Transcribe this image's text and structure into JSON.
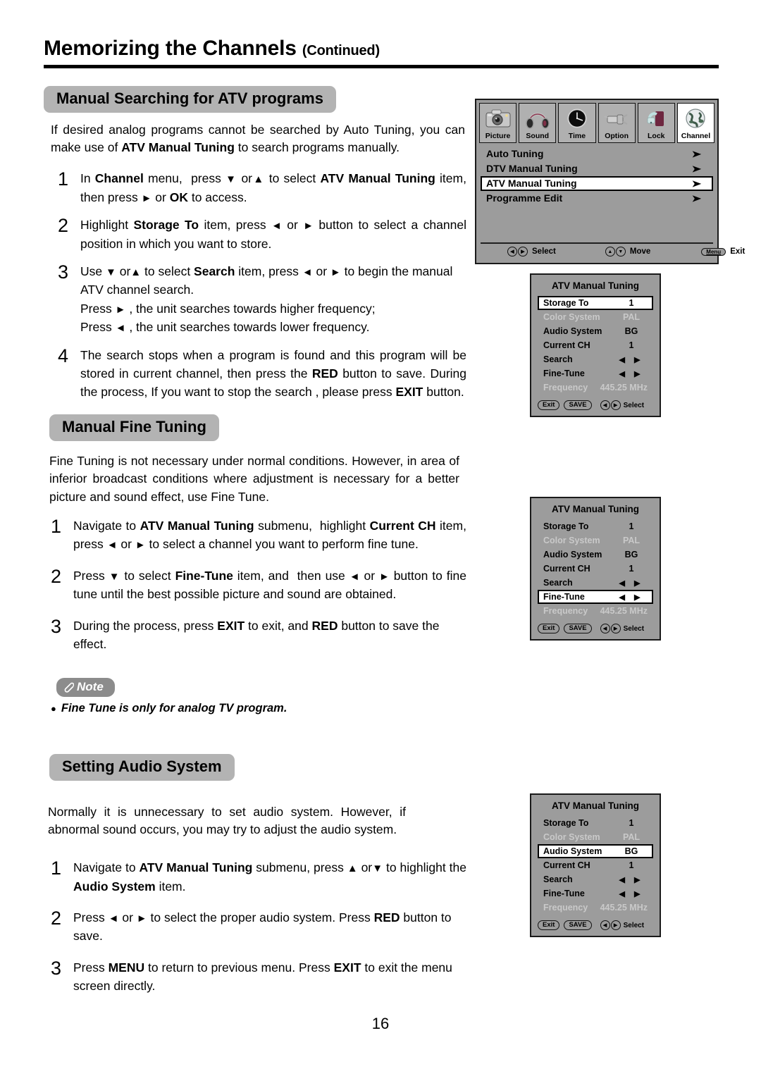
{
  "page": {
    "title": "Memorizing the Channels",
    "title_suffix": "(Continued)",
    "number": "16"
  },
  "sections": {
    "manual_search": {
      "heading": "Manual Searching for ATV programs",
      "intro_html": "If desired analog programs cannot be searched by Auto Tuning, you can make use of <b>ATV Manual Tuning</b> to search programs manually.",
      "steps": [
        {
          "num": "1",
          "html": "In <b>Channel</b> menu,&nbsp; press <span class=\"ar\">&#9660;</span> or<span class=\"ar\">&#9650;</span> to select <b>ATV Manual Tuning</b> item, then press <span class=\"ar\">&#9658;</span> or <b>OK</b> to access."
        },
        {
          "num": "2",
          "html": "Highlight <b>Storage To</b> item, press <span class=\"ar\">&#9668;</span> or <span class=\"ar\">&#9658;</span> button to select a channel position in which you want to store."
        },
        {
          "num": "3",
          "html": "Use <span class=\"ar\">&#9660;</span> or<span class=\"ar\">&#9650;</span> to select <b>Search</b> item, press <span class=\"ar\">&#9668;</span> or <span class=\"ar\">&#9658;</span> to begin the manual ATV channel search.<br>Press <span class=\"ar\">&#9658;</span> , the unit searches towards higher frequency;<br>Press <span class=\"ar\">&#9668;</span> , the unit searches towards lower frequency."
        },
        {
          "num": "4",
          "html": "The search stops when a program is found and this program will be stored in current channel, then press the <b>RED</b> button to save. During the process, If you want to stop the search , please press <b>EXIT</b> button."
        }
      ]
    },
    "fine_tuning": {
      "heading": "Manual Fine Tuning",
      "intro_html": "Fine Tuning is not necessary under normal conditions. However, in area of inferior broadcast conditions where adjustment is necessary for a better picture and sound effect, use Fine Tune.",
      "steps": [
        {
          "num": "1",
          "html": "Navigate to <b>ATV Manual Tuning</b> submenu,&nbsp; highlight <b>Current CH</b> item, press <span class=\"ar\">&#9668;</span> or <span class=\"ar\">&#9658;</span> to select a channel you want to perform fine tune."
        },
        {
          "num": "2",
          "html": "Press <span class=\"ar\">&#9660;</span> to select <b>Fine-Tune</b> item, and&nbsp; then use <span class=\"ar\">&#9668;</span> or <span class=\"ar\">&#9658;</span> button to fine tune until the best possible picture and sound are obtained."
        },
        {
          "num": "3",
          "html": "During the process, press <b>EXIT</b> to exit, and <b>RED</b> button to save the effect."
        }
      ],
      "note_label": "Note",
      "note_items": [
        "Fine Tune is only for analog TV program."
      ]
    },
    "audio_system": {
      "heading": "Setting Audio System",
      "intro_html": "Normally it is unnecessary to set audio system. However, if abnormal sound occurs, you may try to adjust the audio system.",
      "steps": [
        {
          "num": "1",
          "html": "Navigate to <b>ATV Manual Tuning</b> submenu, press <span class=\"ar\">&#9650;</span> or<span class=\"ar\">&#9660;</span> to highlight the <b>Audio System</b> item."
        },
        {
          "num": "2",
          "html": "Press <span class=\"ar\">&#9668;</span> or <span class=\"ar\">&#9658;</span> to select the proper audio system. Press <b>RED</b> button to save."
        },
        {
          "num": "3",
          "html": "Press <b>MENU</b> to return to previous menu. Press <b>EXIT</b> to exit the menu screen directly."
        }
      ]
    }
  },
  "osd_main": {
    "tabs": [
      {
        "label": "Picture",
        "icon": "camera-icon",
        "active": false
      },
      {
        "label": "Sound",
        "icon": "headphones-icon",
        "active": false
      },
      {
        "label": "Time",
        "icon": "clock-icon",
        "active": false
      },
      {
        "label": "Option",
        "icon": "plug-icon",
        "active": false
      },
      {
        "label": "Lock",
        "icon": "padlock-icon",
        "active": false
      },
      {
        "label": "Channel",
        "icon": "globe-icon",
        "active": true
      }
    ],
    "items": [
      {
        "label": "Auto Tuning",
        "selected": false
      },
      {
        "label": "DTV Manual Tuning",
        "selected": false
      },
      {
        "label": "ATV Manual Tuning",
        "selected": true
      },
      {
        "label": "Programme Edit",
        "selected": false
      }
    ],
    "footer": [
      {
        "keys": "◀▶",
        "label": "Select"
      },
      {
        "keys": "▲▼",
        "label": "Move"
      },
      {
        "keys": "Menu",
        "label": "Exit"
      }
    ]
  },
  "osd_atv_panels": [
    {
      "title": "ATV Manual Tuning",
      "selected_key": "Storage To",
      "rows": [
        {
          "key": "Storage To",
          "value": "1",
          "dim": false
        },
        {
          "key": "Color System",
          "value": "PAL",
          "dim": true
        },
        {
          "key": "Audio System",
          "value": "BG",
          "dim": false
        },
        {
          "key": "Current CH",
          "value": "1",
          "dim": false
        },
        {
          "key": "Search",
          "value": "◀ ▶",
          "dim": false
        },
        {
          "key": "Fine-Tune",
          "value": "◀ ▶",
          "dim": false
        },
        {
          "key": "Frequency",
          "value": "445.25 MHz",
          "dim": true
        }
      ],
      "buttons": [
        "Exit",
        "SAVE"
      ],
      "hint_keys": "◀▶",
      "hint_label": "Select"
    },
    {
      "title": "ATV Manual Tuning",
      "selected_key": "Fine-Tune",
      "rows": [
        {
          "key": "Storage To",
          "value": "1",
          "dim": false
        },
        {
          "key": "Color System",
          "value": "PAL",
          "dim": true
        },
        {
          "key": "Audio System",
          "value": "BG",
          "dim": false
        },
        {
          "key": "Current CH",
          "value": "1",
          "dim": false
        },
        {
          "key": "Search",
          "value": "◀ ▶",
          "dim": false
        },
        {
          "key": "Fine-Tune",
          "value": "◀ ▶",
          "dim": false
        },
        {
          "key": "Frequency",
          "value": "445.25 MHz",
          "dim": true
        }
      ],
      "buttons": [
        "Exit",
        "SAVE"
      ],
      "hint_keys": "◀▶",
      "hint_label": "Select"
    },
    {
      "title": "ATV Manual Tuning",
      "selected_key": "Audio System",
      "rows": [
        {
          "key": "Storage To",
          "value": "1",
          "dim": false
        },
        {
          "key": "Color System",
          "value": "PAL",
          "dim": true
        },
        {
          "key": "Audio System",
          "value": "BG",
          "dim": false
        },
        {
          "key": "Current CH",
          "value": "1",
          "dim": false
        },
        {
          "key": "Search",
          "value": "◀ ▶",
          "dim": false
        },
        {
          "key": "Fine-Tune",
          "value": "◀ ▶",
          "dim": false
        },
        {
          "key": "Frequency",
          "value": "445.25 MHz",
          "dim": true
        }
      ],
      "buttons": [
        "Exit",
        "SAVE"
      ],
      "hint_keys": "◀▶",
      "hint_label": "Select"
    }
  ],
  "colors": {
    "pill_gray": "#b3b3b3",
    "osd_gray": "#9c9c9c",
    "note_gray": "#8c8c8c",
    "dim_text": "#c9c9c9"
  }
}
